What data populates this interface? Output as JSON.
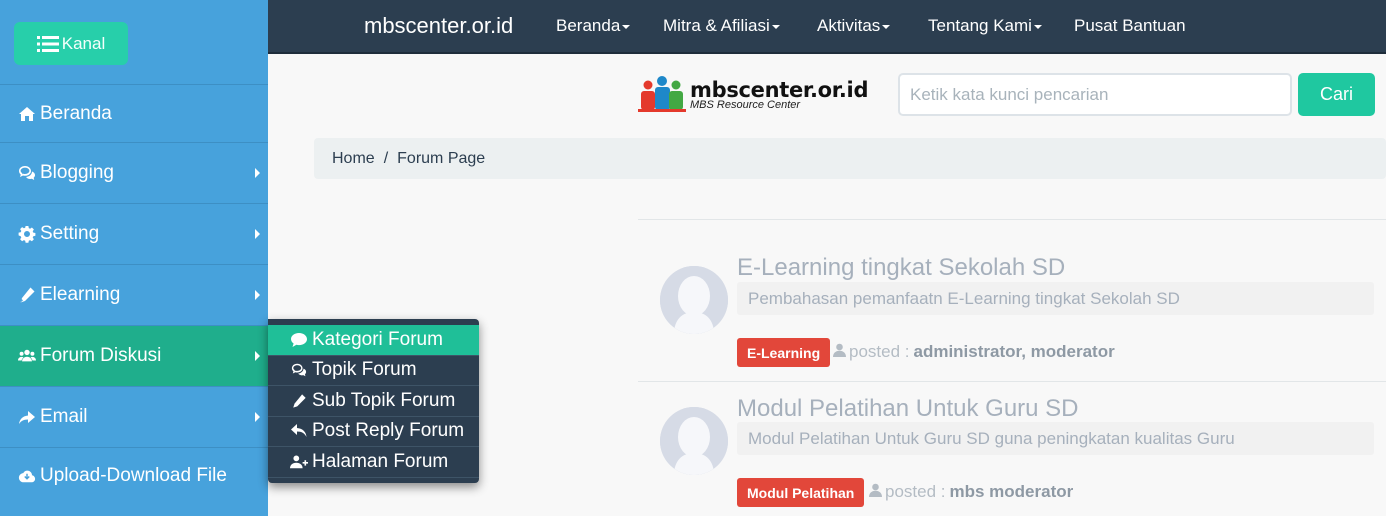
{
  "sidebar": {
    "kanal_label": "Kanal",
    "items": [
      {
        "label": "Beranda",
        "icon": "home-icon",
        "submenu": false
      },
      {
        "label": "Blogging",
        "icon": "comments-icon",
        "submenu": true
      },
      {
        "label": "Setting",
        "icon": "gear-icon",
        "submenu": true
      },
      {
        "label": "Elearning",
        "icon": "pencil-icon",
        "submenu": true
      },
      {
        "label": "Forum Diskusi",
        "icon": "users-icon",
        "submenu": true,
        "active": true
      },
      {
        "label": "Email",
        "icon": "share-icon",
        "submenu": true
      },
      {
        "label": "Upload-Download File",
        "icon": "cloud-icon",
        "submenu": false
      }
    ]
  },
  "submenu": {
    "items": [
      {
        "label": "Kategori Forum",
        "icon": "comment-icon",
        "active": true
      },
      {
        "label": "Topik Forum",
        "icon": "comments-icon"
      },
      {
        "label": "Sub Topik Forum",
        "icon": "pencil-icon"
      },
      {
        "label": "Post Reply Forum",
        "icon": "reply-icon"
      },
      {
        "label": "Halaman Forum",
        "icon": "user-plus-icon"
      }
    ]
  },
  "topnav": {
    "brand": "mbscenter.or.id",
    "items": [
      "Beranda",
      "Mitra & Afiliasi",
      "Aktivitas",
      "Tentang Kami",
      "Pusat Bantuan"
    ]
  },
  "logo": {
    "title": "mbscenter.or.id",
    "subtitle": "MBS Resource Center"
  },
  "search": {
    "placeholder": "Ketik kata kunci pencarian",
    "button_label": "Cari"
  },
  "breadcrumb": {
    "items": [
      "Home",
      "Forum Page"
    ],
    "separator": "/"
  },
  "forum": {
    "posted_label": "posted :",
    "topics": [
      {
        "title": "E-Learning tingkat Sekolah SD",
        "description": "Pembahasan pemanfaatn E-Learning tingkat Sekolah SD",
        "badge": "E-Learning",
        "authors": "administrator, moderator"
      },
      {
        "title": "Modul Pelatihan Untuk Guru SD",
        "description": "Modul Pelatihan Untuk Guru SD guna peningkatan kualitas Guru",
        "badge": "Modul Pelatihan",
        "authors": "mbs moderator"
      }
    ]
  },
  "colors": {
    "sidebar": "#47a2dc",
    "accent": "#1fc8a0",
    "nav": "#2c3e50",
    "badge": "#e2473a"
  }
}
